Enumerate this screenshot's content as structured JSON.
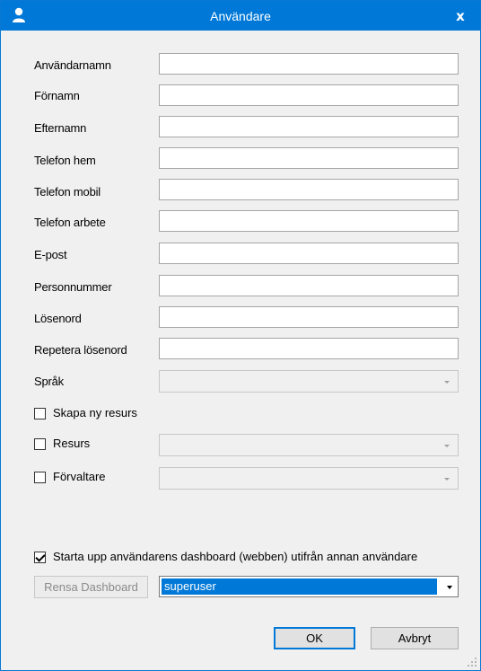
{
  "window": {
    "title": "Användare",
    "close_glyph": "x",
    "title_icon": "user-icon"
  },
  "fields": [
    {
      "label": "Användarnamn",
      "value": ""
    },
    {
      "label": "Förnamn",
      "value": ""
    },
    {
      "label": "Efternamn",
      "value": ""
    },
    {
      "label": "Telefon hem",
      "value": ""
    },
    {
      "label": "Telefon mobil",
      "value": ""
    },
    {
      "label": "Telefon arbete",
      "value": ""
    },
    {
      "label": "E-post",
      "value": ""
    },
    {
      "label": "Personnummer",
      "value": ""
    },
    {
      "label": "Lösenord",
      "value": ""
    },
    {
      "label": "Repetera lösenord",
      "value": ""
    }
  ],
  "language": {
    "label": "Språk",
    "value": ""
  },
  "create_resource": {
    "label": "Skapa ny resurs",
    "checked": false
  },
  "resource": {
    "label": "Resurs",
    "checked": false,
    "value": ""
  },
  "administrator": {
    "label": "Förvaltare",
    "checked": false,
    "value": ""
  },
  "dashboard": {
    "label": "Starta upp användarens dashboard (webben) utifrån annan användare",
    "checked": true,
    "clear_button": "Rensa Dashboard",
    "selected_user": "superuser"
  },
  "buttons": {
    "ok": "OK",
    "cancel": "Avbryt"
  },
  "colors": {
    "titlebar": "#0078d7",
    "selection": "#0078d7"
  }
}
